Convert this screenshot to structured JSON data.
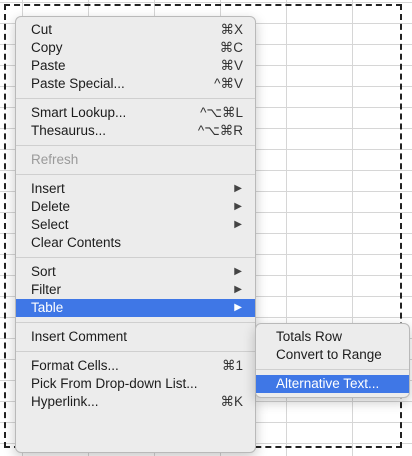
{
  "context_menu": {
    "groups": [
      [
        {
          "label": "Cut",
          "shortcut": "⌘X"
        },
        {
          "label": "Copy",
          "shortcut": "⌘C"
        },
        {
          "label": "Paste",
          "shortcut": "⌘V"
        },
        {
          "label": "Paste Special...",
          "shortcut": "^⌘V"
        }
      ],
      [
        {
          "label": "Smart Lookup...",
          "shortcut": "^⌥⌘L"
        },
        {
          "label": "Thesaurus...",
          "shortcut": "^⌥⌘R"
        }
      ],
      [
        {
          "label": "Refresh",
          "disabled": true
        }
      ],
      [
        {
          "label": "Insert",
          "submenu": true
        },
        {
          "label": "Delete",
          "submenu": true
        },
        {
          "label": "Select",
          "submenu": true
        },
        {
          "label": "Clear Contents"
        }
      ],
      [
        {
          "label": "Sort",
          "submenu": true
        },
        {
          "label": "Filter",
          "submenu": true
        },
        {
          "label": "Table",
          "submenu": true,
          "selected": true
        }
      ],
      [
        {
          "label": "Insert Comment"
        }
      ],
      [
        {
          "label": "Format Cells...",
          "shortcut": "⌘1"
        },
        {
          "label": "Pick From Drop-down List..."
        },
        {
          "label": "Hyperlink...",
          "shortcut": "⌘K"
        }
      ]
    ]
  },
  "table_submenu": {
    "groups": [
      [
        {
          "label": "Totals Row"
        },
        {
          "label": "Convert to Range"
        }
      ],
      [
        {
          "label": "Alternative Text...",
          "selected": true
        }
      ]
    ]
  },
  "submenu_arrow": "▶",
  "colors": {
    "highlight": "#3f77e6",
    "menu_bg": "#ececec",
    "disabled_text": "#9a9a9a"
  }
}
